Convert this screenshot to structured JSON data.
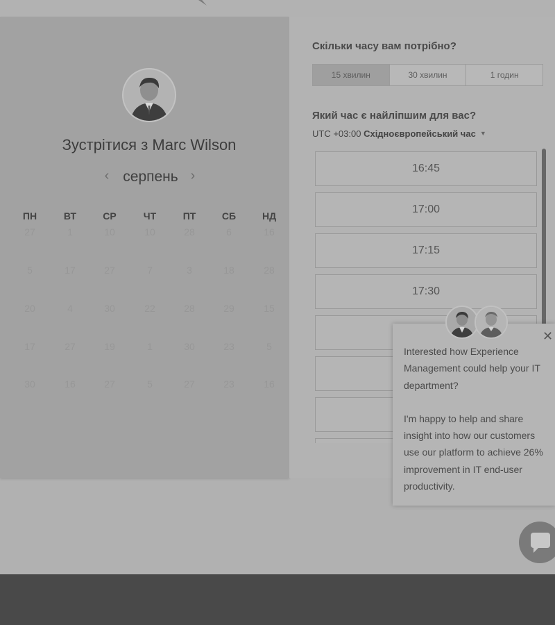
{
  "host": {
    "title": "Зустрітися з Marc Wilson"
  },
  "calendar": {
    "month": "серпень",
    "weekdays": [
      "ПН",
      "ВТ",
      "СР",
      "ЧТ",
      "ПТ",
      "СБ",
      "НД"
    ],
    "weeks": [
      [
        "27",
        "1",
        "10",
        "10",
        "28",
        "6",
        "16"
      ],
      [
        "5",
        "17",
        "27",
        "7",
        "3",
        "18",
        "28"
      ],
      [
        "20",
        "4",
        "30",
        "22",
        "28",
        "29",
        "15"
      ],
      [
        "17",
        "27",
        "19",
        "1",
        "30",
        "23",
        "5"
      ],
      [
        "30",
        "16",
        "27",
        "5",
        "27",
        "23",
        "16"
      ]
    ]
  },
  "duration": {
    "question": "Скільки часу вам потрібно?",
    "options": [
      "15 хвилин",
      "30 хвилин",
      "1 годин"
    ],
    "selected_index": 0
  },
  "time": {
    "question": "Який час є найліпшим для вас?",
    "timezone_offset": "UTC +03:00",
    "timezone_name": "Східноєвропейський час",
    "slots": [
      "16:45",
      "17:00",
      "17:15",
      "17:30",
      "",
      "",
      "",
      ""
    ]
  },
  "popup": {
    "paragraph1": "Interested how Experience Management could help your IT department?",
    "paragraph2": "I'm happy to help and share insight into how our customers use our platform to achieve 26% improvement in IT end-user productivity.",
    "close_label": "✕"
  },
  "icons": {
    "prev": "chevron-left-icon",
    "next": "chevron-right-icon",
    "timezone_caret": "caret-down-icon",
    "close": "close-icon",
    "chat": "chat-bubble-icon"
  },
  "colors": {
    "footer": "#494949",
    "overlay_tint": "#ababab"
  }
}
